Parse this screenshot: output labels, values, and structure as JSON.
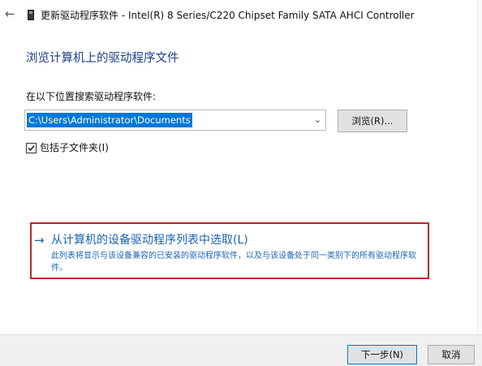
{
  "window": {
    "back_icon": "←",
    "title": "更新驱动程序软件 - Intel(R) 8 Series/C220 Chipset Family SATA AHCI Controller"
  },
  "page": {
    "heading": "浏览计算机上的驱动程序文件",
    "search_label": "在以下位置搜索驱动程序软件:",
    "path_value": "C:\\Users\\Administrator\\Documents",
    "combo_chevron": "⌄",
    "browse_label": "浏览(R)...",
    "include_subfolders_label": "包括子文件夹(I)",
    "include_subfolders_checked": true
  },
  "pick_option": {
    "arrow": "→",
    "title": "从计算机的设备驱动程序列表中选取(L)",
    "description": "此列表将显示与该设备兼容的已安装的驱动程序软件，以及与该设备处于同一类别下的所有驱动程序软件。"
  },
  "footer": {
    "next_label": "下一步(N)",
    "cancel_label": "取消"
  },
  "colors": {
    "heading": "#1f3f8a",
    "link": "#1a63b4",
    "highlight_border": "#c0242b",
    "selection": "#0078d7"
  }
}
